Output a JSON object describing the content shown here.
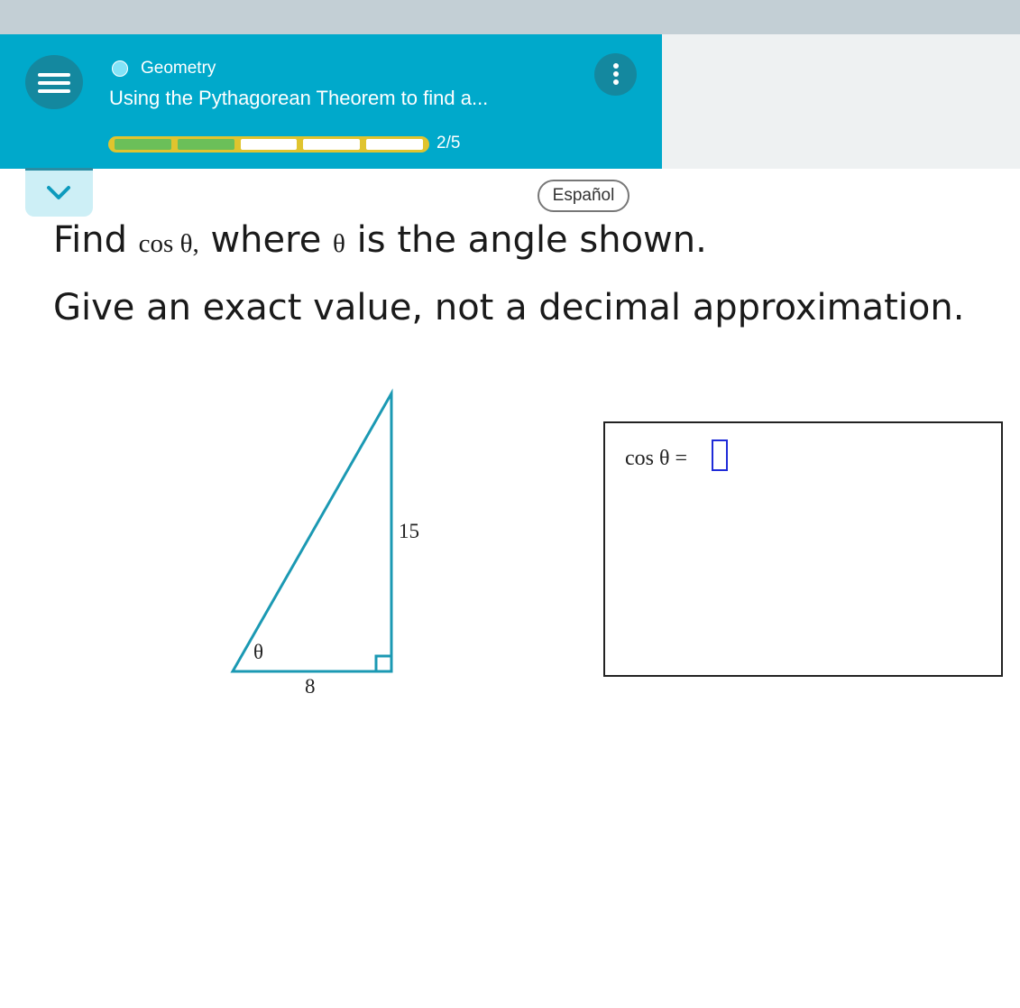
{
  "header": {
    "topic": "Geometry",
    "lesson_title": "Using the Pythagorean Theorem to find a...",
    "progress": {
      "completed": 2,
      "total": 5,
      "label": "2/5"
    },
    "menu_icon": "hamburger-menu-icon",
    "more_icon": "vertical-dots-icon"
  },
  "toolbar": {
    "language_button": "Español",
    "collapse_icon": "chevron-down-icon"
  },
  "question": {
    "prefix": "Find",
    "math_expr": "cos θ,",
    "middle": "where",
    "theta": "θ",
    "suffix": "is the angle shown.",
    "instruction": "Give an exact value, not a decimal approximation."
  },
  "diagram": {
    "vertical_leg": "15",
    "horizontal_leg": "8",
    "angle_label": "θ"
  },
  "answer": {
    "label": "cos θ =",
    "value": ""
  },
  "colors": {
    "header_bg": "#00a9cb",
    "progress_complete": "#6bbf59",
    "progress_incomplete": "#ffffff",
    "progress_border": "#e0c42e",
    "triangle_stroke": "#1b99b3",
    "input_border": "#1f2bd8"
  }
}
